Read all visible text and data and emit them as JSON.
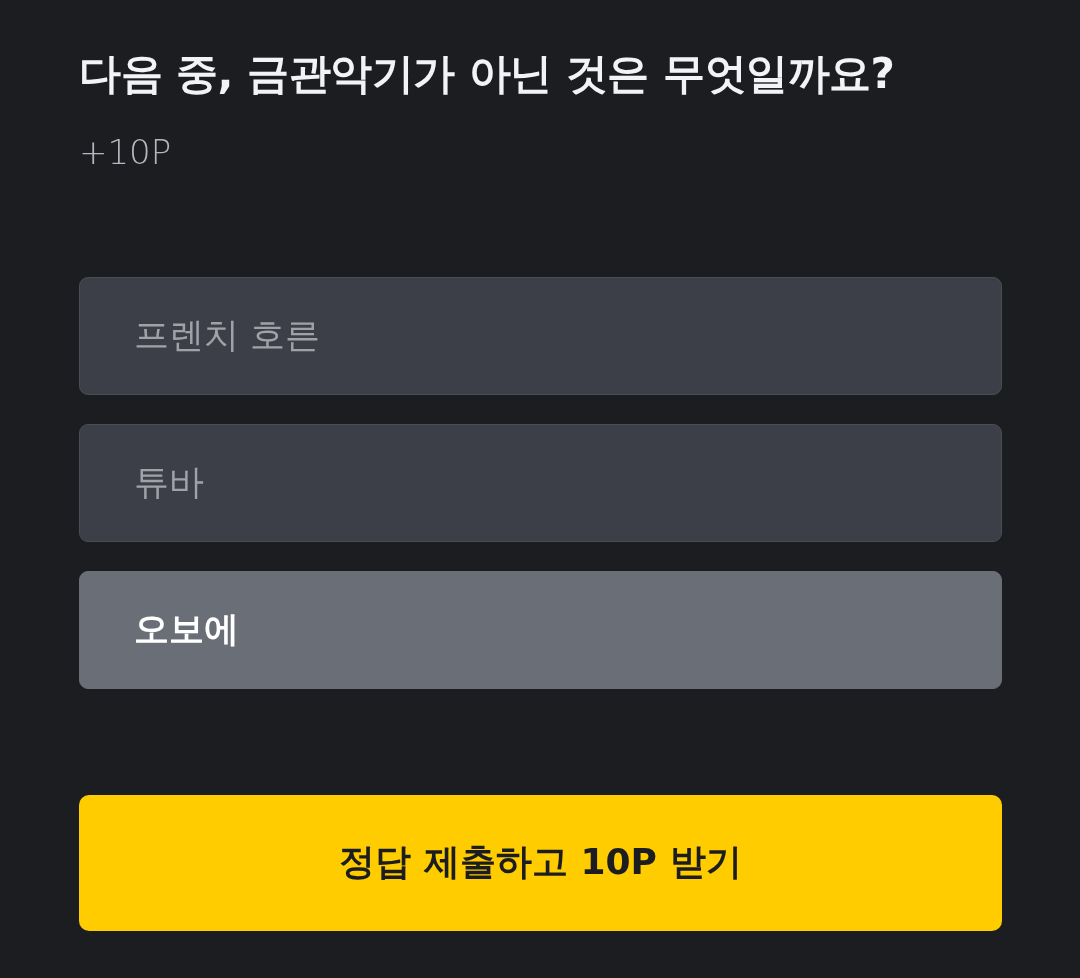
{
  "question": {
    "title": "다음 중, 금관악기가 아닌 것은 무엇일까요?",
    "reward": "+10P"
  },
  "options": [
    {
      "label": "프렌치 호른",
      "selected": false
    },
    {
      "label": "튜바",
      "selected": false
    },
    {
      "label": "오보에",
      "selected": true
    }
  ],
  "submit_button": {
    "label": "정답 제출하고 10P 받기"
  }
}
